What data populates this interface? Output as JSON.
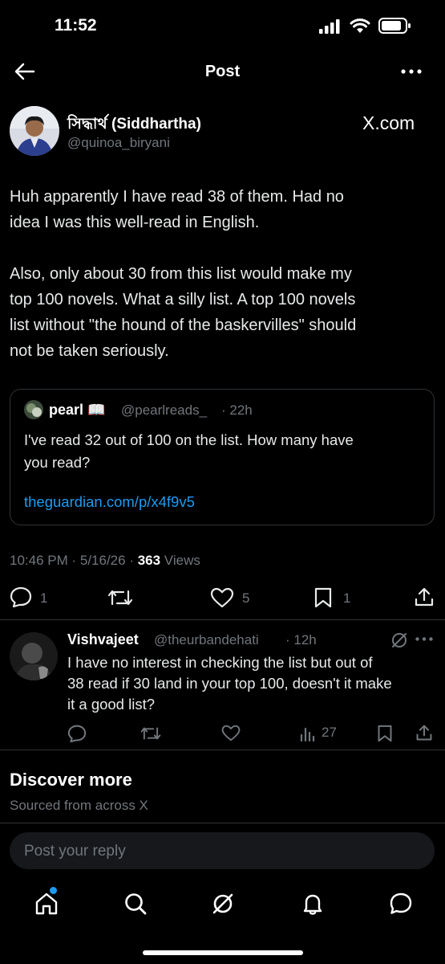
{
  "status_bar": {
    "time": "11:52"
  },
  "header": {
    "title": "Post"
  },
  "post": {
    "author_name": "সিদ্ধার্থ (Siddhartha)",
    "author_handle": "@quinoa_biryani",
    "source_brand": "X.com",
    "text_lines": [
      "Huh apparently I have read 38 of them. Had no",
      "idea I was this well-read in English.",
      "",
      "Also, only about 30 from this list would make my",
      "top 100 novels. What a silly list. A top 100 novels",
      "list without \"the hound of the baskervilles\" should",
      "not be taken seriously."
    ],
    "quote": {
      "author_name": "pearl 📖",
      "author_handle": "@pearlreads_",
      "time": "· 22h",
      "text_lines": [
        "I've read 32 out of 100 on the list. How many have",
        "you read?"
      ],
      "link": "theguardian.com/p/x4f9v5"
    },
    "meta": {
      "timestamp": "10:46 PM · 5/16/26 · ",
      "views_count": "363",
      "views_label": " Views"
    },
    "actions": {
      "replies": "1",
      "likes": "5",
      "bookmarks": "1"
    }
  },
  "reply": {
    "author_name": "Vishvajeet",
    "author_handle": "@theurbandehati",
    "time": "· 12h",
    "text_lines": [
      "I have no interest in checking the list but out of",
      "38 read if 30 land in your top 100, doesn't it make",
      "it a good list?"
    ],
    "views": "27"
  },
  "discover": {
    "title": "Discover more",
    "subtitle": "Sourced from across X"
  },
  "composer": {
    "placeholder": "Post your reply"
  },
  "tab_bar": {
    "items": [
      "home-icon",
      "search-icon",
      "grok-icon",
      "notifications-icon",
      "messages-icon"
    ]
  },
  "colors": {
    "background": "#000000",
    "accent": "#1d9bf0",
    "muted": "#71767b",
    "divider": "#2f3336"
  }
}
